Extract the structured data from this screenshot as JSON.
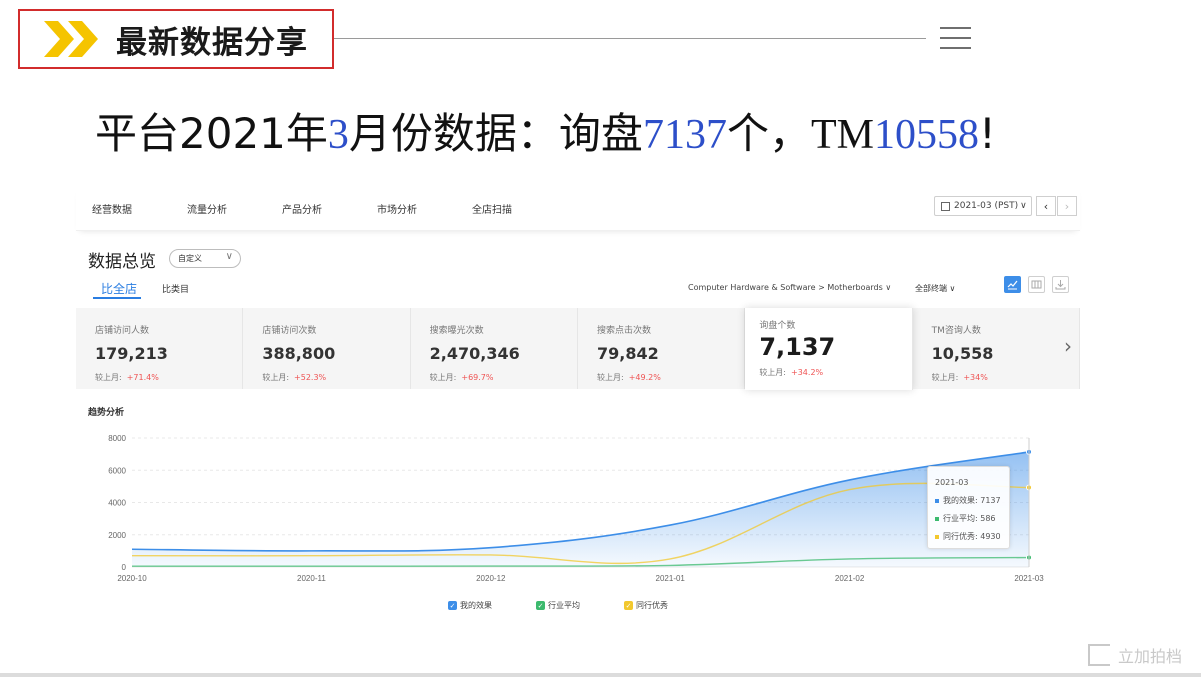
{
  "slide": {
    "title": "最新数据分享",
    "headline_parts": [
      "平台",
      "2021",
      "年",
      "3",
      "月份数据：询盘",
      "7137",
      "个，",
      "TM",
      "10558",
      "!"
    ],
    "accent_color": "#2d4fc9",
    "chevron_color": "#f5c400",
    "frame_color": "#d22c2c"
  },
  "nav": {
    "items": [
      "经营数据",
      "流量分析",
      "产品分析",
      "市场分析",
      "全店扫描"
    ],
    "date": "2021-03 (PST)"
  },
  "overview": {
    "title": "数据总览",
    "custom_select": "自定义",
    "tabs": [
      "比全店",
      "比类目"
    ],
    "category_path": "Computer Hardware & Software > Motherboards",
    "terminal_filter": "全部终端"
  },
  "metrics": [
    {
      "label": "店铺访问人数",
      "value": "179,213",
      "cmp_label": "较上月:",
      "cmp": "+71.4%"
    },
    {
      "label": "店铺访问次数",
      "value": "388,800",
      "cmp_label": "较上月:",
      "cmp": "+52.3%"
    },
    {
      "label": "搜索曝光次数",
      "value": "2,470,346",
      "cmp_label": "较上月:",
      "cmp": "+69.7%"
    },
    {
      "label": "搜索点击次数",
      "value": "79,842",
      "cmp_label": "较上月:",
      "cmp": "+49.2%"
    },
    {
      "label": "询盘个数",
      "value": "7,137",
      "cmp_label": "较上月:",
      "cmp": "+34.2%",
      "selected": true
    },
    {
      "label": "TM咨询人数",
      "value": "10,558",
      "cmp_label": "较上月:",
      "cmp": "+34%"
    }
  ],
  "trend": {
    "title": "趋势分析",
    "tooltip": {
      "date": "2021-03",
      "rows": [
        {
          "label": "我的效果",
          "value": "7137",
          "color": "#3d8ee8"
        },
        {
          "label": "行业平均",
          "value": "586",
          "color": "#3cba6e"
        },
        {
          "label": "同行优秀",
          "value": "4930",
          "color": "#f2c82e"
        }
      ]
    },
    "legend": [
      {
        "label": "我的效果",
        "color": "#3d8ee8"
      },
      {
        "label": "行业平均",
        "color": "#3cba6e"
      },
      {
        "label": "同行优秀",
        "color": "#f2c82e"
      }
    ]
  },
  "chart_data": {
    "type": "area",
    "categories": [
      "2020-10",
      "2020-11",
      "2020-12",
      "2021-01",
      "2021-02",
      "2021-03"
    ],
    "ylim": [
      0,
      8000
    ],
    "yticks": [
      0,
      2000,
      4000,
      6000,
      8000
    ],
    "grid": true,
    "legend_position": "bottom",
    "series": [
      {
        "name": "我的效果",
        "values": [
          1100,
          1000,
          1200,
          2600,
          5400,
          7137
        ],
        "color": "#3d8ee8",
        "fill": true
      },
      {
        "name": "行业平均",
        "values": [
          50,
          50,
          60,
          100,
          500,
          586
        ],
        "color": "#3cba6e"
      },
      {
        "name": "同行优秀",
        "values": [
          700,
          700,
          750,
          500,
          4800,
          4930
        ],
        "color": "#f2c82e"
      }
    ]
  },
  "watermark": "立加拍档"
}
